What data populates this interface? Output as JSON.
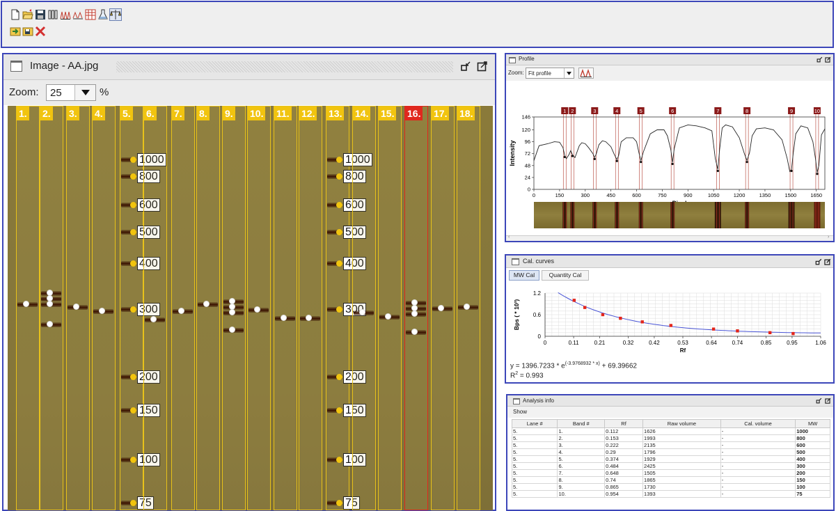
{
  "toolbar": {
    "row1": [
      {
        "icon": "new-file-icon"
      },
      {
        "icon": "open-folder-icon"
      },
      {
        "icon": "save-icon"
      },
      {
        "icon": "lanes-icon"
      },
      {
        "icon": "profile-peaks-icon"
      },
      {
        "icon": "band-peaks-icon"
      },
      {
        "icon": "grid-table-icon"
      },
      {
        "icon": "flask-icon"
      },
      {
        "icon": "calibration-icon",
        "selected": true
      }
    ],
    "row2": [
      {
        "icon": "import-icon"
      },
      {
        "icon": "export-icon"
      },
      {
        "icon": "close-x-icon"
      }
    ]
  },
  "image_panel": {
    "title": "Image - AA.jpg",
    "zoom_label": "Zoom:",
    "zoom_value": "25",
    "zoom_unit": "%"
  },
  "lanes": [
    {
      "label": "1."
    },
    {
      "label": "2."
    },
    {
      "label": "3."
    },
    {
      "label": "4."
    },
    {
      "label": "5."
    },
    {
      "label": "6."
    },
    {
      "label": "7."
    },
    {
      "label": "8."
    },
    {
      "label": "9."
    },
    {
      "label": "10."
    },
    {
      "label": "11."
    },
    {
      "label": "12."
    },
    {
      "label": "13."
    },
    {
      "label": "14."
    },
    {
      "label": "15."
    },
    {
      "label": "16.",
      "selected": true
    },
    {
      "label": "17."
    },
    {
      "label": "18."
    }
  ],
  "markers": [
    "1000",
    "800",
    "600",
    "500",
    "400",
    "300",
    "200",
    "150",
    "100",
    "75"
  ],
  "profile_panel": {
    "title": "Profile",
    "zoom_label": "Zoom:",
    "zoom_value": "Fit profile",
    "peak_labels": [
      "1",
      "2",
      "3",
      "4",
      "5",
      "6",
      "7",
      "8",
      "9",
      "10"
    ],
    "ylabel": "Intensity",
    "xlabel": "Pixel",
    "yticks": [
      "146",
      "120",
      "96",
      "72",
      "48",
      "24",
      "0"
    ],
    "xticks": [
      "0",
      "150",
      "300",
      "450",
      "600",
      "750",
      "900",
      "1050",
      "1200",
      "1350",
      "1500",
      "1650"
    ]
  },
  "cal_panel": {
    "title": "Cal. curves",
    "tabs": [
      "MW Cal",
      "Quantity Cal"
    ],
    "active_tab": "MW Cal",
    "ylabel": "Bps ( * 10³)",
    "xlabel": "Rf",
    "yticks": [
      "1.2",
      "0.6",
      "0"
    ],
    "xticks": [
      "0",
      "0.11",
      "0.21",
      "0.32",
      "0.42",
      "0.53",
      "0.64",
      "0.74",
      "0.85",
      "0.95",
      "1.06"
    ],
    "equation_prefix": "y = 1396.7233 * e",
    "equation_exp": "(-3.9768932 * x)",
    "equation_suffix": " + 69.39662",
    "r2_prefix": "R",
    "r2_sup": "2",
    "r2_suffix": " = 0.993"
  },
  "analysis_panel": {
    "title": "Analysis info",
    "menu": "Show",
    "columns": [
      "Lane #",
      "Band #",
      "Rf",
      "Raw volume",
      "Cal. volume",
      "MW"
    ],
    "rows": [
      [
        "5.",
        "1.",
        "0.112",
        "1626",
        "-",
        "1000"
      ],
      [
        "5.",
        "2.",
        "0.153",
        "1993",
        "-",
        "800"
      ],
      [
        "5.",
        "3.",
        "0.222",
        "2135",
        "-",
        "600"
      ],
      [
        "5.",
        "4.",
        "0.29",
        "1796",
        "-",
        "500"
      ],
      [
        "5.",
        "5.",
        "0.374",
        "1929",
        "-",
        "400"
      ],
      [
        "5.",
        "6.",
        "0.484",
        "2425",
        "-",
        "300"
      ],
      [
        "5.",
        "7.",
        "0.648",
        "1505",
        "-",
        "200"
      ],
      [
        "5.",
        "8.",
        "0.74",
        "1865",
        "-",
        "150"
      ],
      [
        "5.",
        "9.",
        "0.865",
        "1730",
        "-",
        "100"
      ],
      [
        "5.",
        "10.",
        "0.954",
        "1393",
        "-",
        "75"
      ]
    ]
  },
  "chart_data": [
    {
      "type": "line",
      "ylabel": "Intensity",
      "xlabel": "Pixel",
      "ylim": [
        0,
        146
      ],
      "xlim": [
        0,
        1700
      ],
      "x": [
        0,
        30,
        80,
        120,
        150,
        170,
        180,
        190,
        205,
        215,
        225,
        240,
        265,
        280,
        300,
        320,
        345,
        355,
        365,
        380,
        400,
        420,
        450,
        470,
        485,
        495,
        510,
        540,
        580,
        600,
        615,
        625,
        640,
        680,
        720,
        760,
        780,
        800,
        810,
        820,
        850,
        900,
        950,
        1000,
        1040,
        1060,
        1075,
        1085,
        1100,
        1120,
        1160,
        1200,
        1230,
        1245,
        1260,
        1275,
        1300,
        1350,
        1400,
        1450,
        1480,
        1495,
        1505,
        1515,
        1530,
        1560,
        1600,
        1630,
        1645,
        1655,
        1665,
        1680,
        1700
      ],
      "series": [
        {
          "values": [
            58,
            88,
            92,
            96,
            95,
            84,
            68,
            62,
            70,
            78,
            70,
            64,
            88,
            94,
            92,
            84,
            72,
            64,
            72,
            90,
            98,
            96,
            86,
            70,
            60,
            68,
            96,
            104,
            104,
            96,
            72,
            58,
            76,
            112,
            120,
            120,
            108,
            80,
            54,
            82,
            124,
            130,
            128,
            124,
            118,
            62,
            40,
            80,
            124,
            130,
            126,
            104,
            72,
            58,
            74,
            108,
            122,
            124,
            120,
            100,
            62,
            36,
            40,
            72,
            112,
            128,
            124,
            96,
            62,
            34,
            48,
            110,
            122
          ]
        }
      ]
    },
    {
      "type": "scatter",
      "xlabel": "Rf",
      "ylabel": "Bps ( * 10³)",
      "xlim": [
        0,
        1.06
      ],
      "ylim": [
        0,
        1.2
      ],
      "points": {
        "x": [
          0.112,
          0.153,
          0.222,
          0.29,
          0.374,
          0.484,
          0.648,
          0.74,
          0.865,
          0.954
        ],
        "y": [
          1.0,
          0.8,
          0.6,
          0.5,
          0.4,
          0.3,
          0.2,
          0.15,
          0.1,
          0.075
        ]
      },
      "fit": {
        "a": 1396.7233,
        "b": -3.9768932,
        "c": 69.39662,
        "type": "exponential"
      }
    }
  ]
}
